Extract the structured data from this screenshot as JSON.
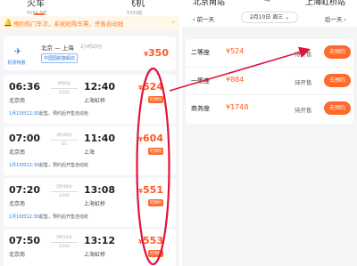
{
  "left": {
    "tabs": [
      {
        "label": "火车",
        "sub": "¥164.5起"
      },
      {
        "label": "飞机",
        "sub": "¥350起"
      }
    ],
    "notice": {
      "text": "预约热门车次，系统抢购车票，开售自动抢",
      "chevron": "›"
    },
    "flight": {
      "badge_icon": "✈",
      "badge_text": "机票特惠",
      "route": "北京 — 上海",
      "duration": "2小时25分",
      "tag": "中国国航旗舰店",
      "currency": "¥",
      "price": "350"
    },
    "trains": [
      {
        "dep": "06:36",
        "arr": "12:40",
        "from": "北京南",
        "to": "上海虹桥",
        "dur": "6时4分",
        "no": "G101",
        "currency": "¥",
        "price": "524",
        "badge": "可预约",
        "note_time": "1月10日12:30",
        "note_rest": "起售，预约后开售自动抢"
      },
      {
        "dep": "07:00",
        "arr": "11:40",
        "from": "北京南",
        "to": "上海",
        "dur": "4时40分",
        "no": "G1",
        "currency": "¥",
        "price": "604",
        "badge": "可预约",
        "note_time": "1月10日12:30",
        "note_rest": "起售，预约后开售自动抢"
      },
      {
        "dep": "07:20",
        "arr": "13:08",
        "from": "北京南",
        "to": "上海虹桥",
        "dur": "5时48分",
        "no": "G103",
        "currency": "¥",
        "price": "551",
        "badge": "可预约",
        "note_time": "1月10日12:30",
        "note_rest": "起售，预约后开售自动抢"
      },
      {
        "dep": "07:50",
        "arr": "13:12",
        "from": "北京南",
        "to": "上海虹桥",
        "dur": "5时22分",
        "no": "G143",
        "currency": "¥",
        "price": "553",
        "badge": "可预约",
        "note_time": "",
        "note_rest": ""
      }
    ]
  },
  "right": {
    "station_a": "北京南站",
    "station_b": "上海虹桥站",
    "route_arrow": "→",
    "prev_day": "‹ 前一天",
    "next_day": "后一天 ›",
    "date": "2月10日 周三 ⌄",
    "seats": [
      {
        "name": "二等座",
        "price": "¥524",
        "status": "待开售",
        "button": "去预约"
      },
      {
        "name": "一等座",
        "price": "¥884",
        "status": "待开售",
        "button": "去预约"
      },
      {
        "name": "商务座",
        "price": "¥1748",
        "status": "待开售",
        "button": "去预约"
      }
    ]
  },
  "colors": {
    "accent": "#ff6a2b",
    "price": "#ff5a1f",
    "link": "#2a7ae2",
    "annotation": "#e0143c"
  }
}
